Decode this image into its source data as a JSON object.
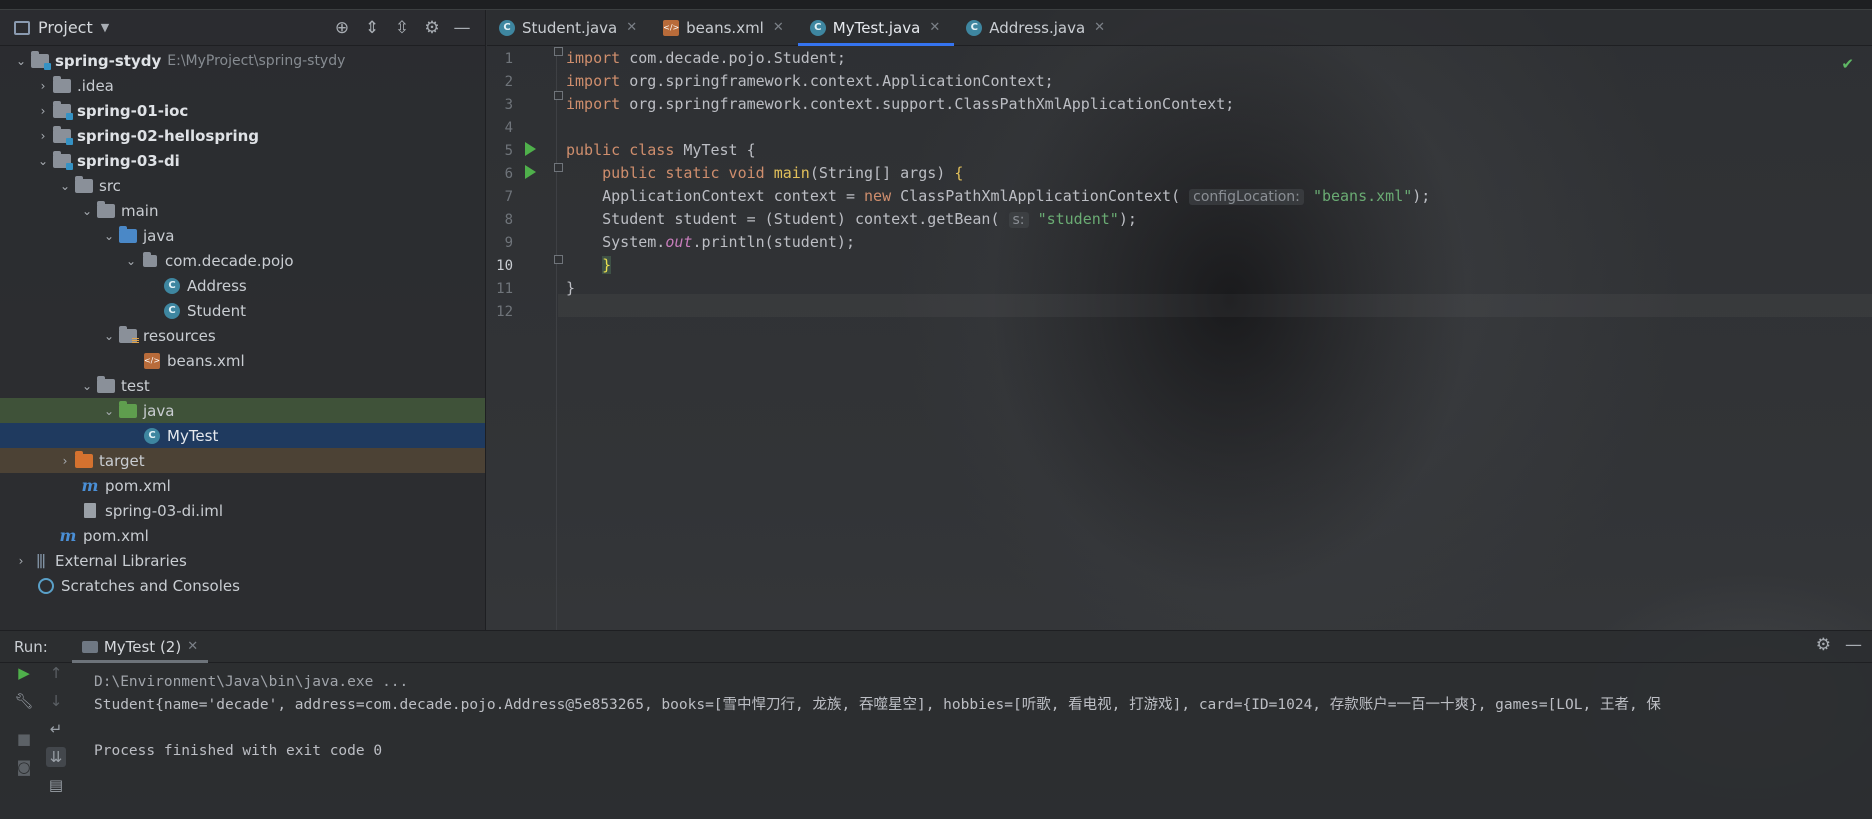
{
  "project_panel": {
    "title": "Project",
    "tree": [
      {
        "label": "spring-stydy",
        "path": "E:\\MyProject\\spring-stydy"
      },
      {
        "label": ".idea"
      },
      {
        "label": "spring-01-ioc"
      },
      {
        "label": "spring-02-hellospring"
      },
      {
        "label": "spring-03-di"
      },
      {
        "label": "src"
      },
      {
        "label": "main"
      },
      {
        "label": "java"
      },
      {
        "label": "com.decade.pojo"
      },
      {
        "label": "Address"
      },
      {
        "label": "Student"
      },
      {
        "label": "resources"
      },
      {
        "label": "beans.xml"
      },
      {
        "label": "test"
      },
      {
        "label": "java"
      },
      {
        "label": "MyTest"
      },
      {
        "label": "target"
      },
      {
        "label": "pom.xml"
      },
      {
        "label": "spring-03-di.iml"
      },
      {
        "label": "pom.xml"
      },
      {
        "label": "External Libraries"
      },
      {
        "label": "Scratches and Consoles"
      }
    ]
  },
  "tabs": [
    {
      "label": "Student.java"
    },
    {
      "label": "beans.xml"
    },
    {
      "label": "MyTest.java"
    },
    {
      "label": "Address.java"
    }
  ],
  "editor": {
    "line_numbers": [
      "1",
      "2",
      "3",
      "4",
      "5",
      "6",
      "7",
      "8",
      "9",
      "10",
      "11",
      "12"
    ],
    "code": {
      "l1": "com.decade.pojo.Student;",
      "l2": "org.springframework.context.ApplicationContext;",
      "l3": "org.springframework.context.support.ClassPathXmlApplicationContext;",
      "l5_class": "MyTest {",
      "l6_sig": "(String[] args) ",
      "l7_pre": "    ApplicationContext context = ",
      "l7_mid": " ClassPathXmlApplicationContext(",
      "l7_hint": "configLocation:",
      "l7_str": "\"beans.xml\"",
      "l7_end": ");",
      "l8_pre": "    Student student = (Student) context.getBean(",
      "l8_hint": "s:",
      "l8_str": "\"student\"",
      "l8_end": ");",
      "l9_pre": "    System.",
      "l9_field": "out",
      "l9_end": ".println(student);"
    }
  },
  "run_panel": {
    "label": "Run:",
    "tab": "MyTest (2)",
    "console": [
      "D:\\Environment\\Java\\bin\\java.exe ...",
      "Student{name='decade', address=com.decade.pojo.Address@5e853265, books=[雪中悍刀行, 龙族, 吞噬星空], hobbies=[听歌, 看电视, 打游戏], card={ID=1024, 存款账户=一百一十爽}, games=[LOL, 王者, 保",
      "",
      "Process finished with exit code 0"
    ]
  }
}
